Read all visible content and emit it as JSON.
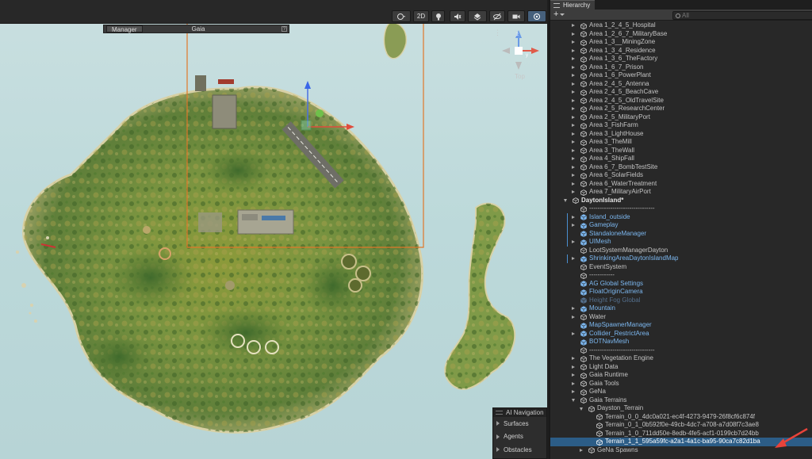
{
  "scene_toolbar": {
    "mode_2d_label": "2D",
    "icons": [
      "shading-mode-icon",
      "lighting-icon",
      "audio-icon",
      "effects-icon",
      "hidden-objects-icon",
      "camera-icon",
      "gizmos-icon"
    ]
  },
  "gaia_panel": {
    "manager_label": "Manager",
    "title": "Gaia",
    "help_glyph": "?"
  },
  "gizmo": {
    "menu_glyph": "⋮",
    "view_label": "Top",
    "axis_labels": {
      "y": "y",
      "z": "z"
    }
  },
  "ai_navigation": {
    "title": "AI Navigation",
    "items": [
      "Surfaces",
      "Agents",
      "Obstacles"
    ]
  },
  "hierarchy": {
    "tab_title": "Hierarchy",
    "add_glyph": "+",
    "search_placeholder": "All",
    "rows": [
      {
        "label": "Area 1_2_4_5_Hospital",
        "indent": 1,
        "fold": "closed",
        "type": "normal"
      },
      {
        "label": "Area 1_2_6_7_MilitaryBase",
        "indent": 1,
        "fold": "closed",
        "type": "normal"
      },
      {
        "label": "Area 1_3__MiningZone",
        "indent": 1,
        "fold": "closed",
        "type": "normal"
      },
      {
        "label": "Area 1_3_4_Residence",
        "indent": 1,
        "fold": "closed",
        "type": "normal"
      },
      {
        "label": "Area 1_3_6_TheFactory",
        "indent": 1,
        "fold": "closed",
        "type": "normal"
      },
      {
        "label": "Area 1_6_7_Prison",
        "indent": 1,
        "fold": "closed",
        "type": "normal"
      },
      {
        "label": "Area 1_6_PowerPlant",
        "indent": 1,
        "fold": "closed",
        "type": "normal"
      },
      {
        "label": "Area 2_4_5_Antenna",
        "indent": 1,
        "fold": "closed",
        "type": "normal"
      },
      {
        "label": "Area 2_4_5_BeachCave",
        "indent": 1,
        "fold": "closed",
        "type": "normal"
      },
      {
        "label": "Area 2_4_5_OldTravelSite",
        "indent": 1,
        "fold": "closed",
        "type": "normal"
      },
      {
        "label": "Area 2_5_ResearchCenter",
        "indent": 1,
        "fold": "closed",
        "type": "normal"
      },
      {
        "label": "Area 2_5_MilitaryPort",
        "indent": 1,
        "fold": "closed",
        "type": "normal"
      },
      {
        "label": "Area 3_FishFarm",
        "indent": 1,
        "fold": "closed",
        "type": "normal"
      },
      {
        "label": "Area 3_LightHouse",
        "indent": 1,
        "fold": "closed",
        "type": "normal"
      },
      {
        "label": "Area 3_TheMill",
        "indent": 1,
        "fold": "closed",
        "type": "normal"
      },
      {
        "label": "Area 3_TheWall",
        "indent": 1,
        "fold": "closed",
        "type": "normal"
      },
      {
        "label": "Area 4_ShipFall",
        "indent": 1,
        "fold": "closed",
        "type": "normal"
      },
      {
        "label": "Area 6_7_BombTestSite",
        "indent": 1,
        "fold": "closed",
        "type": "normal"
      },
      {
        "label": "Area 6_SolarFields",
        "indent": 1,
        "fold": "closed",
        "type": "normal"
      },
      {
        "label": "Area 6_WaterTreatment",
        "indent": 1,
        "fold": "closed",
        "type": "normal"
      },
      {
        "label": "Area 7_MilitaryAirPort",
        "indent": 1,
        "fold": "closed",
        "type": "normal"
      },
      {
        "label": "DaytonIsland*",
        "indent": 0,
        "fold": "open",
        "type": "scene"
      },
      {
        "label": "-------------------------------",
        "indent": 1,
        "fold": "none",
        "type": "normal"
      },
      {
        "label": "Island_outside",
        "indent": 1,
        "fold": "closed",
        "type": "prefab",
        "mark": true
      },
      {
        "label": "Gameplay",
        "indent": 1,
        "fold": "closed",
        "type": "prefab",
        "mark": true
      },
      {
        "label": "StandaloneManager",
        "indent": 1,
        "fold": "none",
        "type": "prefab",
        "mark": true
      },
      {
        "label": "UIMesh",
        "indent": 1,
        "fold": "closed",
        "type": "prefab",
        "mark": true
      },
      {
        "label": "LootSystemManagerDayton",
        "indent": 1,
        "fold": "none",
        "type": "normal"
      },
      {
        "label": "ShrinkingAreaDaytonIslandMap",
        "indent": 1,
        "fold": "closed",
        "type": "prefab",
        "mark": true
      },
      {
        "label": "EventSystem",
        "indent": 1,
        "fold": "none",
        "type": "normal"
      },
      {
        "label": "------------",
        "indent": 1,
        "fold": "none",
        "type": "normal"
      },
      {
        "label": "AG Global Settings",
        "indent": 1,
        "fold": "none",
        "type": "prefab"
      },
      {
        "label": "FloatOriginCamera",
        "indent": 1,
        "fold": "none",
        "type": "prefab"
      },
      {
        "label": "Height Fog Global",
        "indent": 1,
        "fold": "none",
        "type": "disabled"
      },
      {
        "label": "Mountain",
        "indent": 1,
        "fold": "closed",
        "type": "prefab"
      },
      {
        "label": "Water",
        "indent": 1,
        "fold": "closed",
        "type": "normal"
      },
      {
        "label": "MapSpawnerManager",
        "indent": 1,
        "fold": "none",
        "type": "prefab"
      },
      {
        "label": "Collider_RestrictArea",
        "indent": 1,
        "fold": "closed",
        "type": "prefab"
      },
      {
        "label": "BOTNavMesh",
        "indent": 1,
        "fold": "none",
        "type": "prefab"
      },
      {
        "label": "-------------------------------",
        "indent": 1,
        "fold": "none",
        "type": "normal"
      },
      {
        "label": "The Vegetation Engine",
        "indent": 1,
        "fold": "closed",
        "type": "normal"
      },
      {
        "label": "Light Data",
        "indent": 1,
        "fold": "closed",
        "type": "normal"
      },
      {
        "label": "Gaia Runtime",
        "indent": 1,
        "fold": "closed",
        "type": "normal"
      },
      {
        "label": "Gaia Tools",
        "indent": 1,
        "fold": "closed",
        "type": "normal"
      },
      {
        "label": "GeNa",
        "indent": 1,
        "fold": "closed",
        "type": "normal"
      },
      {
        "label": "Gaia Terrains",
        "indent": 1,
        "fold": "open",
        "type": "normal"
      },
      {
        "label": "Dayston_Terrain",
        "indent": 2,
        "fold": "open",
        "type": "normal"
      },
      {
        "label": "Terrain_0_0_4dc0a021-ec4f-4273-9479-26f8cf6c874f",
        "indent": 3,
        "fold": "none",
        "type": "normal"
      },
      {
        "label": "Terrain_0_1_0b592f0e-49cb-4dc7-a708-a7d08f7c3ae8",
        "indent": 3,
        "fold": "none",
        "type": "normal"
      },
      {
        "label": "Terrain_1_0_711dd50e-8edb-4fe5-acf1-0199cb7d24bb",
        "indent": 3,
        "fold": "none",
        "type": "normal"
      },
      {
        "label": "Terrain_1_1_595a59fc-a2a1-4a1c-ba95-90ca7c82d1ba",
        "indent": 3,
        "fold": "none",
        "type": "normal",
        "selected": true
      },
      {
        "label": "GeNa Spawns",
        "indent": 2,
        "fold": "closed",
        "type": "normal"
      }
    ]
  },
  "colors": {
    "selection": "#2c5d87",
    "prefab_text": "#7cb7ef",
    "annotation_arrow": "#e8433a",
    "camera_frame": "#e0782a"
  }
}
